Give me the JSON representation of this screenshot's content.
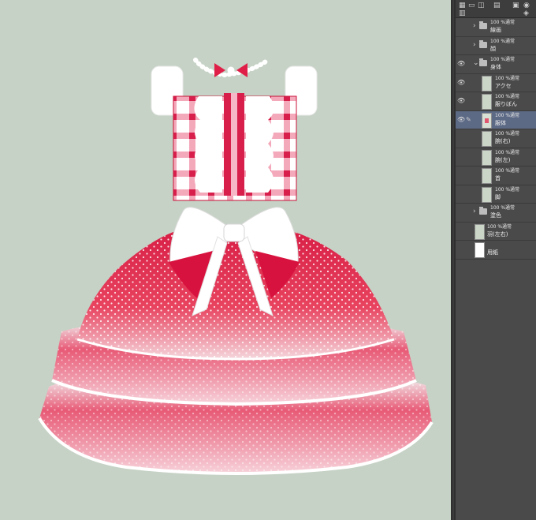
{
  "canvas": {
    "background": "#c6d2c5",
    "colors": {
      "dress_red": "#e23a5a",
      "dress_deep": "#c8123a",
      "ribbon": "#ffffff",
      "checker_pink": "#f6b7c6"
    }
  },
  "panel": {
    "toolbar_icons": [
      "new-layer-icon",
      "folder-icon",
      "clip-icon",
      "trash-icon",
      "lock-icon",
      "settings-icon"
    ],
    "layers": [
      {
        "mode": "100 %通常",
        "name": "線画",
        "type": "folder",
        "visible": false,
        "expanded": false
      },
      {
        "mode": "100 %通常",
        "name": "顔",
        "type": "folder",
        "visible": false,
        "expanded": false
      },
      {
        "mode": "100 %通常",
        "name": "身体",
        "type": "folder",
        "visible": true,
        "expanded": true
      },
      {
        "mode": "100 %通常",
        "name": "アクセ",
        "type": "layer",
        "visible": true
      },
      {
        "mode": "100 %通常",
        "name": "服りぼん",
        "type": "layer",
        "visible": true
      },
      {
        "mode": "100 %通常",
        "name": "服体",
        "type": "layer",
        "visible": true,
        "active": true
      },
      {
        "mode": "100 %通常",
        "name": "腕(右)",
        "type": "layer",
        "visible": false
      },
      {
        "mode": "100 %通常",
        "name": "腕(左)",
        "type": "layer",
        "visible": false
      },
      {
        "mode": "100 %通常",
        "name": "首",
        "type": "layer",
        "visible": false
      },
      {
        "mode": "100 %通常",
        "name": "脚",
        "type": "layer",
        "visible": false
      },
      {
        "mode": "100 %通常",
        "name": "塗色",
        "type": "folder",
        "visible": false,
        "expanded": false
      },
      {
        "mode": "100 %通常",
        "name": "羽(左右)",
        "type": "layer",
        "visible": false
      },
      {
        "mode": "",
        "name": "用紙",
        "type": "paper",
        "visible": false
      }
    ]
  }
}
